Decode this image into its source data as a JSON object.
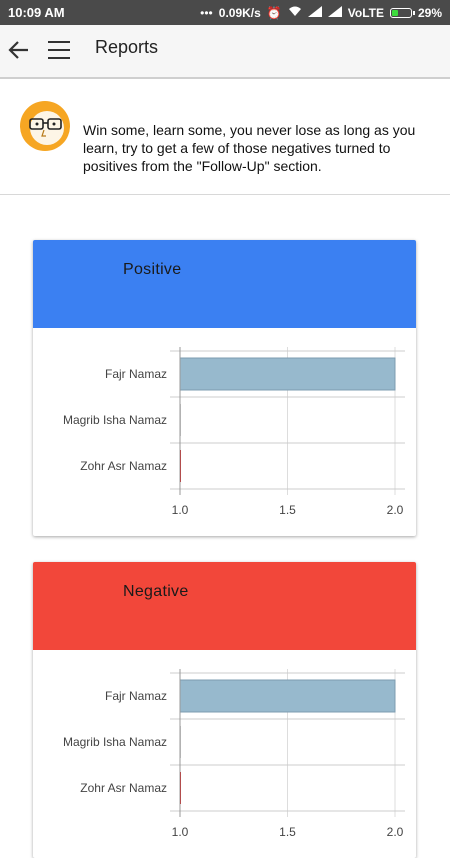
{
  "status_bar": {
    "time": "10:09 AM",
    "speed": "0.09K/s",
    "network": "VoLTE",
    "battery_percent": "29%",
    "battery_level": 0.29,
    "icons": [
      "dots-icon",
      "alarm-icon",
      "wifi-icon",
      "signal-icon",
      "signal-icon",
      "battery-icon"
    ]
  },
  "app_bar": {
    "title": "Reports",
    "back_icon": "back-arrow-icon",
    "menu_icon": "hamburger-menu-icon"
  },
  "message": {
    "avatar_icon": "glasses-face-avatar-icon",
    "text": "Win some, learn some, you never lose as long as you learn, try to get a few of those negatives turned to positives from the \"Follow-Up\" section."
  },
  "colors": {
    "positive": "#3b80f2",
    "negative": "#f2473a",
    "bar_fill": "#97b9cd",
    "small_bar": "#cc0000"
  },
  "chart_data": [
    {
      "type": "bar",
      "orientation": "horizontal",
      "title": "Positive",
      "categories": [
        "Fajr Namaz",
        "Magrib Isha Namaz",
        "Zohr Asr Namaz"
      ],
      "values": [
        2.0,
        1.0,
        1.0
      ],
      "xlim": [
        1.0,
        2.0
      ],
      "xticks": [
        "1.0",
        "1.5",
        "2.0"
      ],
      "grid": true
    },
    {
      "type": "bar",
      "orientation": "horizontal",
      "title": "Negative",
      "categories": [
        "Fajr Namaz",
        "Magrib Isha Namaz",
        "Zohr Asr Namaz"
      ],
      "values": [
        2.0,
        1.0,
        1.0
      ],
      "xlim": [
        1.0,
        2.0
      ],
      "xticks": [
        "1.0",
        "1.5",
        "2.0"
      ],
      "grid": true
    }
  ]
}
